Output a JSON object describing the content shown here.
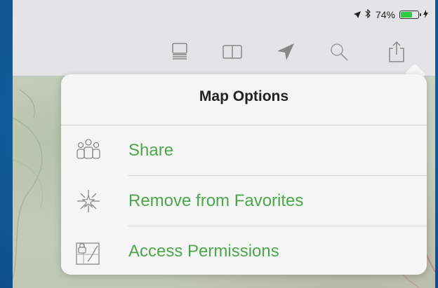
{
  "status_bar": {
    "location_icon": "location-arrow-icon",
    "bluetooth_icon": "bluetooth-icon",
    "battery_text": "74%",
    "battery_level": 0.74,
    "battery_color": "#2ecc40"
  },
  "toolbar": {
    "items": [
      {
        "name": "layers-icon"
      },
      {
        "name": "book-icon"
      },
      {
        "name": "location-arrow-icon"
      },
      {
        "name": "search-icon"
      },
      {
        "name": "share-icon"
      }
    ]
  },
  "popover": {
    "title": "Map Options",
    "accent_color": "#4aa84a",
    "items": [
      {
        "label": "Share",
        "icon": "people-icon"
      },
      {
        "label": "Remove from Favorites",
        "icon": "star-burst-icon"
      },
      {
        "label": "Access Permissions",
        "icon": "map-lock-icon"
      }
    ]
  }
}
